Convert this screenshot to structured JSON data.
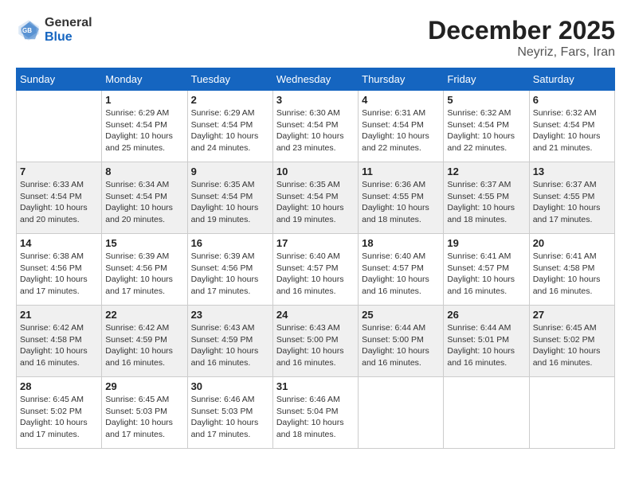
{
  "header": {
    "logo_general": "General",
    "logo_blue": "Blue",
    "month_year": "December 2025",
    "location": "Neyriz, Fars, Iran"
  },
  "days_of_week": [
    "Sunday",
    "Monday",
    "Tuesday",
    "Wednesday",
    "Thursday",
    "Friday",
    "Saturday"
  ],
  "weeks": [
    [
      {
        "day": "",
        "info": ""
      },
      {
        "day": "1",
        "info": "Sunrise: 6:29 AM\nSunset: 4:54 PM\nDaylight: 10 hours\nand 25 minutes."
      },
      {
        "day": "2",
        "info": "Sunrise: 6:29 AM\nSunset: 4:54 PM\nDaylight: 10 hours\nand 24 minutes."
      },
      {
        "day": "3",
        "info": "Sunrise: 6:30 AM\nSunset: 4:54 PM\nDaylight: 10 hours\nand 23 minutes."
      },
      {
        "day": "4",
        "info": "Sunrise: 6:31 AM\nSunset: 4:54 PM\nDaylight: 10 hours\nand 22 minutes."
      },
      {
        "day": "5",
        "info": "Sunrise: 6:32 AM\nSunset: 4:54 PM\nDaylight: 10 hours\nand 22 minutes."
      },
      {
        "day": "6",
        "info": "Sunrise: 6:32 AM\nSunset: 4:54 PM\nDaylight: 10 hours\nand 21 minutes."
      }
    ],
    [
      {
        "day": "7",
        "info": "Sunrise: 6:33 AM\nSunset: 4:54 PM\nDaylight: 10 hours\nand 20 minutes."
      },
      {
        "day": "8",
        "info": "Sunrise: 6:34 AM\nSunset: 4:54 PM\nDaylight: 10 hours\nand 20 minutes."
      },
      {
        "day": "9",
        "info": "Sunrise: 6:35 AM\nSunset: 4:54 PM\nDaylight: 10 hours\nand 19 minutes."
      },
      {
        "day": "10",
        "info": "Sunrise: 6:35 AM\nSunset: 4:54 PM\nDaylight: 10 hours\nand 19 minutes."
      },
      {
        "day": "11",
        "info": "Sunrise: 6:36 AM\nSunset: 4:55 PM\nDaylight: 10 hours\nand 18 minutes."
      },
      {
        "day": "12",
        "info": "Sunrise: 6:37 AM\nSunset: 4:55 PM\nDaylight: 10 hours\nand 18 minutes."
      },
      {
        "day": "13",
        "info": "Sunrise: 6:37 AM\nSunset: 4:55 PM\nDaylight: 10 hours\nand 17 minutes."
      }
    ],
    [
      {
        "day": "14",
        "info": "Sunrise: 6:38 AM\nSunset: 4:56 PM\nDaylight: 10 hours\nand 17 minutes."
      },
      {
        "day": "15",
        "info": "Sunrise: 6:39 AM\nSunset: 4:56 PM\nDaylight: 10 hours\nand 17 minutes."
      },
      {
        "day": "16",
        "info": "Sunrise: 6:39 AM\nSunset: 4:56 PM\nDaylight: 10 hours\nand 17 minutes."
      },
      {
        "day": "17",
        "info": "Sunrise: 6:40 AM\nSunset: 4:57 PM\nDaylight: 10 hours\nand 16 minutes."
      },
      {
        "day": "18",
        "info": "Sunrise: 6:40 AM\nSunset: 4:57 PM\nDaylight: 10 hours\nand 16 minutes."
      },
      {
        "day": "19",
        "info": "Sunrise: 6:41 AM\nSunset: 4:57 PM\nDaylight: 10 hours\nand 16 minutes."
      },
      {
        "day": "20",
        "info": "Sunrise: 6:41 AM\nSunset: 4:58 PM\nDaylight: 10 hours\nand 16 minutes."
      }
    ],
    [
      {
        "day": "21",
        "info": "Sunrise: 6:42 AM\nSunset: 4:58 PM\nDaylight: 10 hours\nand 16 minutes."
      },
      {
        "day": "22",
        "info": "Sunrise: 6:42 AM\nSunset: 4:59 PM\nDaylight: 10 hours\nand 16 minutes."
      },
      {
        "day": "23",
        "info": "Sunrise: 6:43 AM\nSunset: 4:59 PM\nDaylight: 10 hours\nand 16 minutes."
      },
      {
        "day": "24",
        "info": "Sunrise: 6:43 AM\nSunset: 5:00 PM\nDaylight: 10 hours\nand 16 minutes."
      },
      {
        "day": "25",
        "info": "Sunrise: 6:44 AM\nSunset: 5:00 PM\nDaylight: 10 hours\nand 16 minutes."
      },
      {
        "day": "26",
        "info": "Sunrise: 6:44 AM\nSunset: 5:01 PM\nDaylight: 10 hours\nand 16 minutes."
      },
      {
        "day": "27",
        "info": "Sunrise: 6:45 AM\nSunset: 5:02 PM\nDaylight: 10 hours\nand 16 minutes."
      }
    ],
    [
      {
        "day": "28",
        "info": "Sunrise: 6:45 AM\nSunset: 5:02 PM\nDaylight: 10 hours\nand 17 minutes."
      },
      {
        "day": "29",
        "info": "Sunrise: 6:45 AM\nSunset: 5:03 PM\nDaylight: 10 hours\nand 17 minutes."
      },
      {
        "day": "30",
        "info": "Sunrise: 6:46 AM\nSunset: 5:03 PM\nDaylight: 10 hours\nand 17 minutes."
      },
      {
        "day": "31",
        "info": "Sunrise: 6:46 AM\nSunset: 5:04 PM\nDaylight: 10 hours\nand 18 minutes."
      },
      {
        "day": "",
        "info": ""
      },
      {
        "day": "",
        "info": ""
      },
      {
        "day": "",
        "info": ""
      }
    ]
  ]
}
